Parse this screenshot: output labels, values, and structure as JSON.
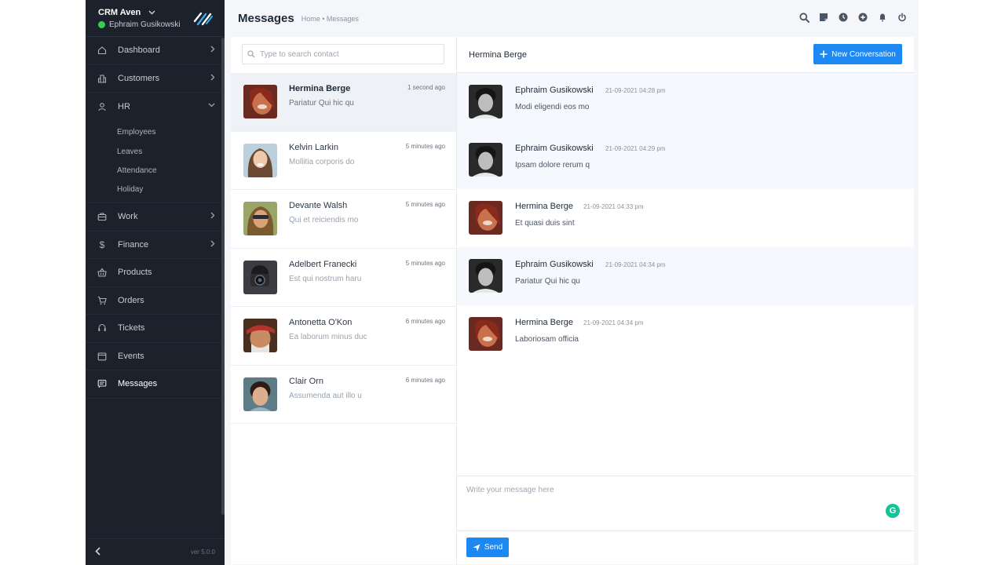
{
  "app": {
    "name": "CRM Aven",
    "user": "Ephraim Gusikowski",
    "version": "ver 5.0.0"
  },
  "sidebar": {
    "items": [
      {
        "label": "Dashboard",
        "icon": "home-icon"
      },
      {
        "label": "Customers",
        "icon": "building-icon"
      },
      {
        "label": "HR",
        "icon": "user-icon"
      },
      {
        "label": "Work",
        "icon": "briefcase-icon"
      },
      {
        "label": "Finance",
        "icon": "dollar-icon"
      },
      {
        "label": "Products",
        "icon": "basket-icon"
      },
      {
        "label": "Orders",
        "icon": "cart-icon"
      },
      {
        "label": "Tickets",
        "icon": "headset-icon"
      },
      {
        "label": "Events",
        "icon": "calendar-icon"
      },
      {
        "label": "Messages",
        "icon": "message-icon"
      }
    ],
    "hr_sub": [
      "Employees",
      "Leaves",
      "Attendance",
      "Holiday"
    ]
  },
  "header": {
    "title": "Messages",
    "breadcrumb": "Home • Messages",
    "icons": [
      "search-icon",
      "note-icon",
      "clock-icon",
      "plus-circle-icon",
      "bell-icon",
      "power-icon"
    ]
  },
  "search": {
    "placeholder": "Type to search contact"
  },
  "contacts": [
    {
      "name": "Hermina Berge",
      "time": "1 second ago",
      "snippet": "Pariatur Qui hic qu"
    },
    {
      "name": "Kelvin Larkin",
      "time": "5 minutes ago",
      "snippet": "Mollitia corporis do"
    },
    {
      "name": "Devante Walsh",
      "time": "5 minutes ago",
      "snippet": "Qui et reiciendis mo"
    },
    {
      "name": "Adelbert Franecki",
      "time": "5 minutes ago",
      "snippet": "Est qui nostrum haru"
    },
    {
      "name": "Antonetta O'Kon",
      "time": "6 minutes ago",
      "snippet": "Ea laborum minus duc"
    },
    {
      "name": "Clair Orn",
      "time": "6 minutes ago",
      "snippet": "Assumenda aut illo u"
    }
  ],
  "conversation": {
    "title": "Hermina Berge",
    "new_button": "New Conversation",
    "messages": [
      {
        "author": "Ephraim Gusikowski",
        "time": "21-09-2021 04:28 pm",
        "text": "Modi eligendi eos mo"
      },
      {
        "author": "Ephraim Gusikowski",
        "time": "21-09-2021 04:29 pm",
        "text": "Ipsam dolore rerum q"
      },
      {
        "author": "Hermina Berge",
        "time": "21-09-2021 04:33 pm",
        "text": "Et quasi duis sint"
      },
      {
        "author": "Ephraim Gusikowski",
        "time": "21-09-2021 04:34 pm",
        "text": "Pariatur Qui hic qu"
      },
      {
        "author": "Hermina Berge",
        "time": "21-09-2021 04:34 pm",
        "text": "Laboriosam officia"
      }
    ],
    "composer_placeholder": "Write your message here",
    "send_label": "Send"
  },
  "colors": {
    "sidebar_bg": "#1b222c",
    "accent": "#1d88f2",
    "online": "#2fd24a",
    "grammarly": "#15c39a"
  }
}
